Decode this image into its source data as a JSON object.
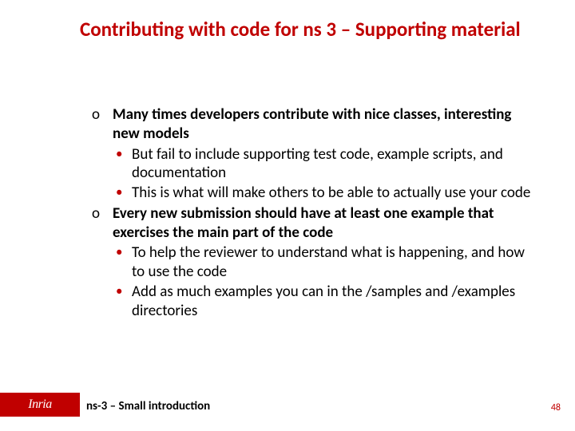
{
  "title": "Contributing with code for ns 3 – Supporting material",
  "content": {
    "items": [
      {
        "marker": "o",
        "text": "Many times developers contribute with nice classes, interesting new models",
        "sub": [
          "But fail to include supporting test code, example scripts, and documentation",
          "This is what will make others to be able to actually use your code"
        ]
      },
      {
        "marker": "o",
        "text": "Every new submission should have at least one example that exercises the main part of the code",
        "sub": [
          "To help the reviewer to understand what is happening, and how to use the code",
          " Add as much examples you can in the  /samples and /examples directories"
        ]
      }
    ]
  },
  "footer": {
    "logo": "Inria",
    "text": "ns-3 – Small introduction",
    "page": "48"
  },
  "colors": {
    "accent": "#c00000"
  }
}
